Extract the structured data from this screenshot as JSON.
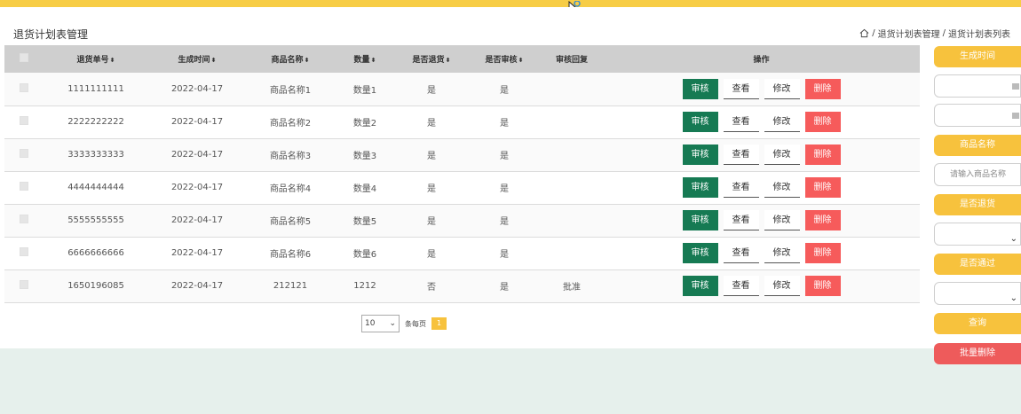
{
  "header": {
    "title": "退货计划表管理",
    "breadcrumb": [
      "退货计划表管理",
      "退货计划表列表"
    ]
  },
  "table": {
    "columns": [
      "退货单号",
      "生成时间",
      "商品名称",
      "数量",
      "是否退货",
      "是否审核",
      "审核回复",
      "操作"
    ],
    "rows": [
      {
        "no": "1111111111",
        "time": "2022-04-17",
        "name": "商品名称1",
        "qty": "数量1",
        "returned": "是",
        "audited": "是",
        "reply": ""
      },
      {
        "no": "2222222222",
        "time": "2022-04-17",
        "name": "商品名称2",
        "qty": "数量2",
        "returned": "是",
        "audited": "是",
        "reply": ""
      },
      {
        "no": "3333333333",
        "time": "2022-04-17",
        "name": "商品名称3",
        "qty": "数量3",
        "returned": "是",
        "audited": "是",
        "reply": ""
      },
      {
        "no": "4444444444",
        "time": "2022-04-17",
        "name": "商品名称4",
        "qty": "数量4",
        "returned": "是",
        "audited": "是",
        "reply": ""
      },
      {
        "no": "5555555555",
        "time": "2022-04-17",
        "name": "商品名称5",
        "qty": "数量5",
        "returned": "是",
        "audited": "是",
        "reply": ""
      },
      {
        "no": "6666666666",
        "time": "2022-04-17",
        "name": "商品名称6",
        "qty": "数量6",
        "returned": "是",
        "audited": "是",
        "reply": ""
      },
      {
        "no": "1650196085",
        "time": "2022-04-17",
        "name": "212121",
        "qty": "1212",
        "returned": "否",
        "audited": "是",
        "reply": "批准"
      }
    ],
    "actions": {
      "audit": "审核",
      "view": "查看",
      "edit": "修改",
      "delete": "删除"
    }
  },
  "pager": {
    "page_size": "10",
    "per_page_label": "条每页",
    "current_page": "1"
  },
  "side": {
    "gen_time_label": "生成时间",
    "product_label": "商品名称",
    "product_placeholder": "请输入商品名称",
    "returned_label": "是否退货",
    "passed_label": "是否通过",
    "search_label": "查询",
    "batch_delete_label": "批量删除"
  },
  "colors": {
    "accent": "#f7c23d",
    "audit": "#167a53",
    "delete": "#f65b5b",
    "header_bar": "#cfcfcf"
  }
}
